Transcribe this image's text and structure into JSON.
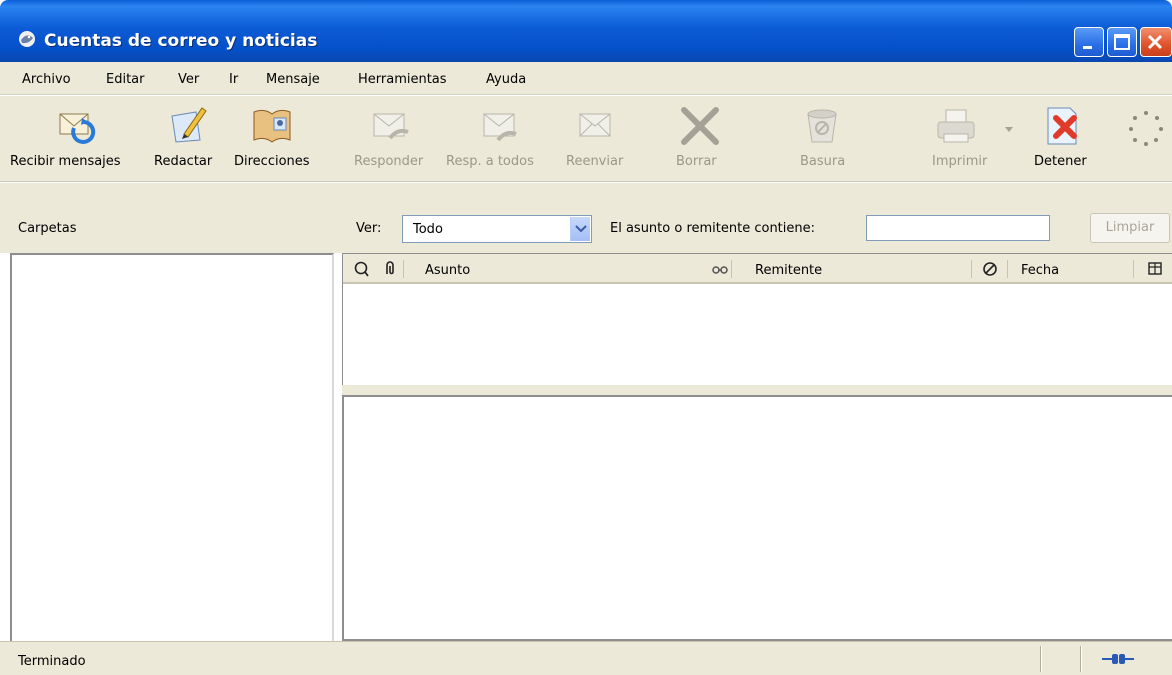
{
  "window": {
    "title": "Cuentas de correo y noticias"
  },
  "menu": [
    "Archivo",
    "Editar",
    "Ver",
    "Ir",
    "Mensaje",
    "Herramientas",
    "Ayuda"
  ],
  "toolbar": {
    "get_messages": "Recibir mensajes",
    "compose": "Redactar",
    "addresses": "Direcciones",
    "reply": "Responder",
    "reply_all": "Resp. a todos",
    "forward": "Reenviar",
    "delete": "Borrar",
    "junk": "Basura",
    "print": "Imprimir",
    "stop": "Detener"
  },
  "folders": {
    "header": "Carpetas"
  },
  "filter": {
    "view_label": "Ver:",
    "view_value": "Todo",
    "search_label": "El asunto o remitente contiene:",
    "search_value": "",
    "clear_label": "Limpiar"
  },
  "thread_columns": {
    "subject": "Asunto",
    "sender": "Remitente",
    "date": "Fecha"
  },
  "status": {
    "text": "Terminado"
  },
  "colors": {
    "titlebar": "#0a5fd8",
    "chrome": "#ece9d8",
    "disabled_text": "#9a9888"
  }
}
